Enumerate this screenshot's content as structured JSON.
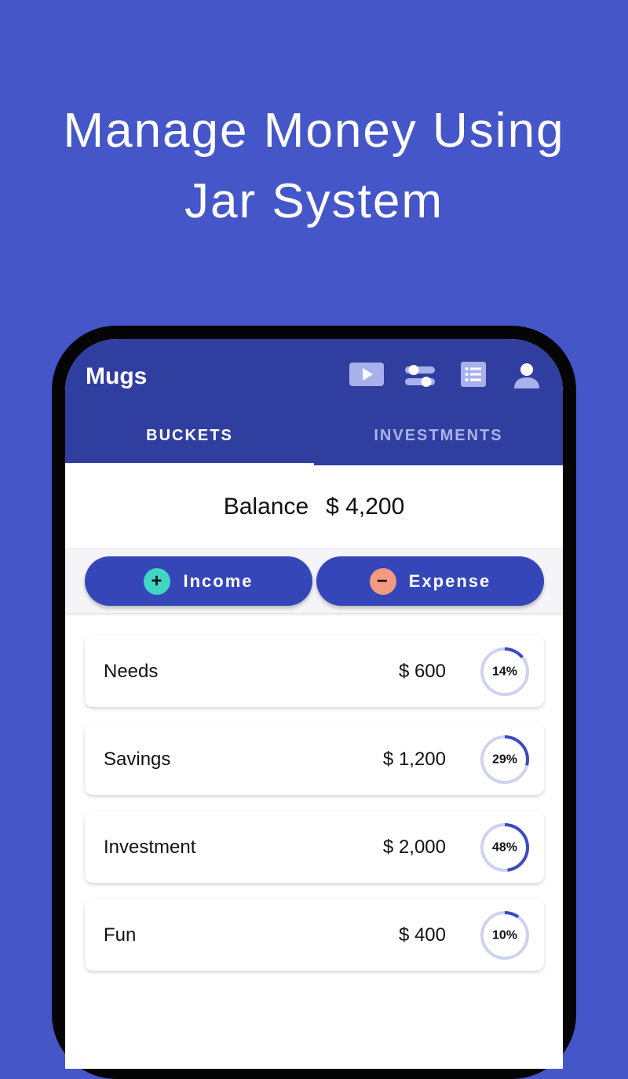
{
  "headline": {
    "line1": "Manage Money Using",
    "line2": "Jar System"
  },
  "app": {
    "title": "Mugs",
    "icons": [
      "video-icon",
      "toggle-icon",
      "list-icon",
      "person-icon"
    ]
  },
  "tabs": [
    {
      "label": "BUCKETS",
      "active": true
    },
    {
      "label": "INVESTMENTS",
      "active": false
    }
  ],
  "balance": {
    "label": "Balance",
    "value": "$ 4,200"
  },
  "actions": {
    "income": {
      "label": "Income",
      "icon": "+"
    },
    "expense": {
      "label": "Expense",
      "icon": "−"
    }
  },
  "buckets": [
    {
      "name": "Needs",
      "amount": "$ 600",
      "percent_label": "14%",
      "percent": 14
    },
    {
      "name": "Savings",
      "amount": "$ 1,200",
      "percent_label": "29%",
      "percent": 29
    },
    {
      "name": "Investment",
      "amount": "$ 2,000",
      "percent_label": "48%",
      "percent": 48
    },
    {
      "name": "Fun",
      "amount": "$ 400",
      "percent_label": "10%",
      "percent": 10
    }
  ],
  "colors": {
    "background": "#4556c8",
    "appbar": "#303f9f",
    "button": "#3546b9",
    "income_circle": "#3fd6c4",
    "expense_circle": "#f39a80",
    "ring_track": "#cdd2f0",
    "ring_progress": "#3a4cc0"
  }
}
